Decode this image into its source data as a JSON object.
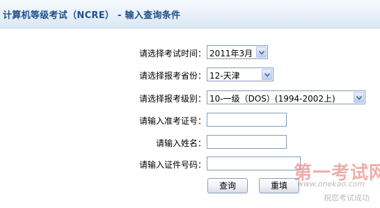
{
  "header": {
    "title": "计算机等级考试（NCRE） - 输入查询条件"
  },
  "form": {
    "exam_time": {
      "label": "请选择考试时间：",
      "value": "2011年3月"
    },
    "province": {
      "label": "请选择报考省份：",
      "value": "12-天津"
    },
    "level": {
      "label": "请选择报考级别：",
      "value": "10-一级（DOS）(1994-2002上)"
    },
    "ticket_number": {
      "label": "请输入准考证号：",
      "value": ""
    },
    "name": {
      "label": "请输入姓名：",
      "value": ""
    },
    "id_number": {
      "label": "请输入证件号码：",
      "value": ""
    }
  },
  "buttons": {
    "query": "查询",
    "reset": "重填"
  },
  "watermark": {
    "title": "第一考试网",
    "url": "www.onekao.com",
    "slogan": "祝您考试成功"
  },
  "colors": {
    "header_text": "#1f4f8a",
    "header_background": "#e6eff8",
    "border": "#7f9db9",
    "watermark_red": "#e47a73"
  }
}
